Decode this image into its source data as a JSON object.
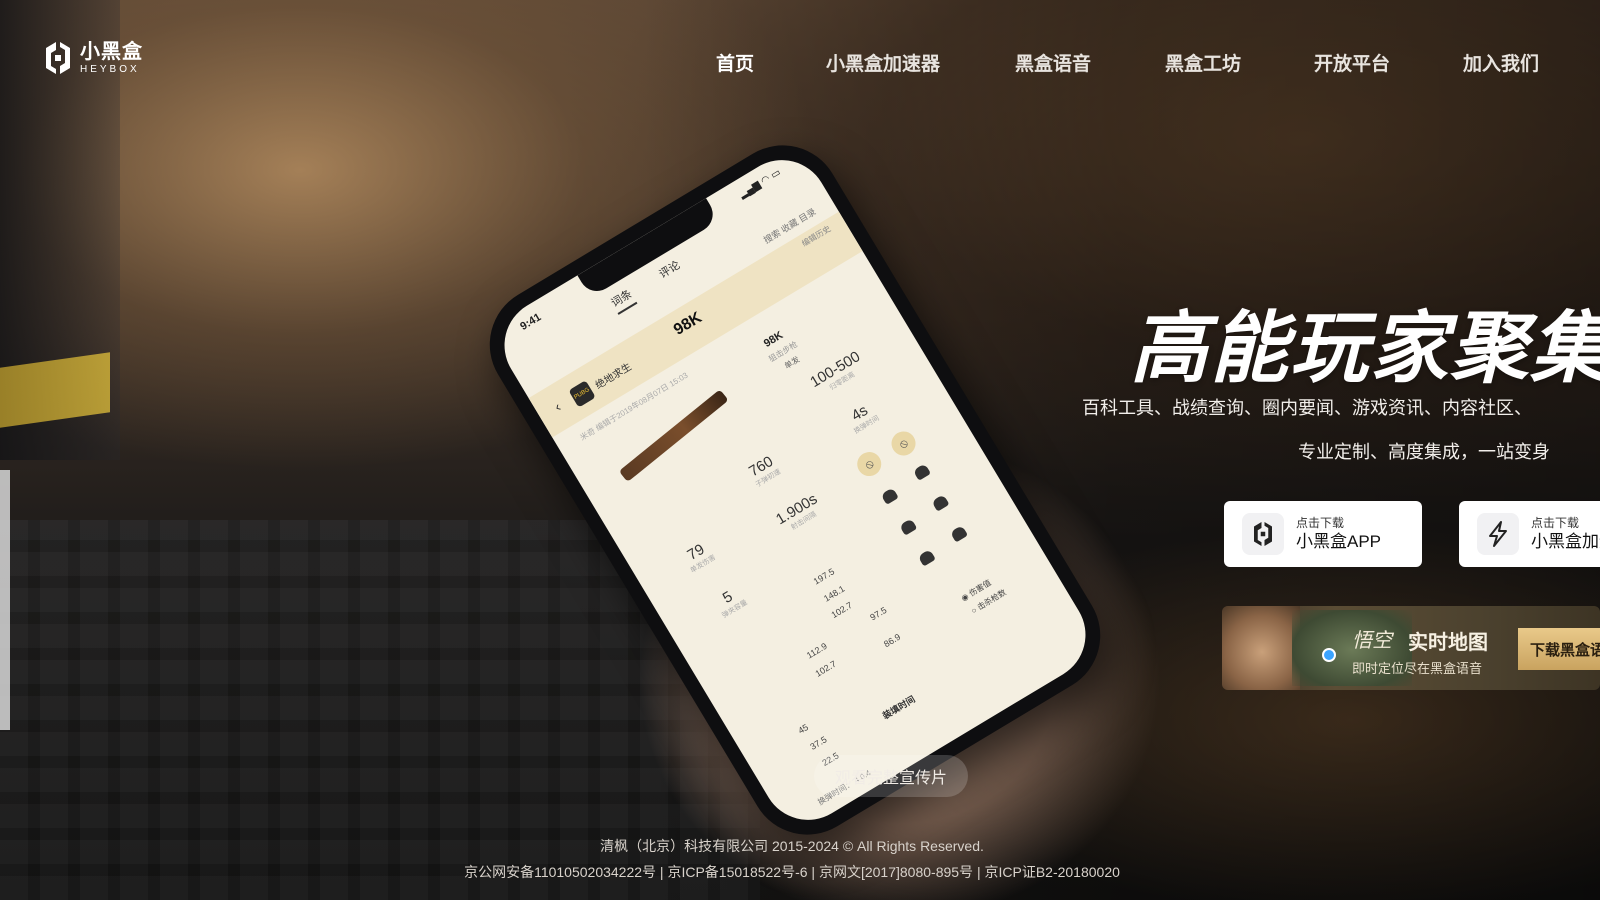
{
  "brand": {
    "name_cn": "小黑盒",
    "name_en": "HEYBOX",
    "logo_icon": "heybox-logo-icon"
  },
  "nav": {
    "items": [
      {
        "label": "首页",
        "active": true
      },
      {
        "label": "小黑盒加速器",
        "active": false
      },
      {
        "label": "黑盒语音",
        "active": false
      },
      {
        "label": "黑盒工坊",
        "active": false
      },
      {
        "label": "开放平台",
        "active": false
      },
      {
        "label": "加入我们",
        "active": false
      }
    ]
  },
  "hero": {
    "title": "高能玩家聚集",
    "subtitle_line1": "百科工具、战绩查询、圈内要闻、游戏资讯、内容社区、",
    "subtitle_line2": "专业定制、高度集成，一站变身"
  },
  "downloads": [
    {
      "small": "点击下载",
      "big": "小黑盒APP",
      "icon": "heybox-app-icon"
    },
    {
      "small": "点击下载",
      "big": "小黑盒加速器",
      "icon": "lightning-icon"
    }
  ],
  "banner": {
    "logo_text": "悟空",
    "title": "实时地图",
    "subtitle": "即时定位尽在黑盒语音",
    "button": "下载黑盒语音"
  },
  "video": {
    "watch_label": "观看完整宣传片"
  },
  "phone_screen": {
    "time": "9:41",
    "tabs": [
      "词条",
      "评论"
    ],
    "actions": "搜索   收藏   目录",
    "game": "绝地求生",
    "game_badge": "PUBG",
    "title": "98K",
    "edit_history": "编辑历史",
    "meta": "米奇  编辑于2019年08月07日 15:03",
    "gun_name": "98K",
    "gun_type": "狙击步枪",
    "gun_mode": "单发",
    "stats": [
      {
        "value": "100-500",
        "label": "归零距离"
      },
      {
        "value": "760",
        "label": "子弹初速"
      },
      {
        "value": "4s",
        "label": "换弹时间"
      },
      {
        "value": "79",
        "label": "单发伤害"
      },
      {
        "value": "1.900s",
        "label": "射击间隔"
      },
      {
        "value": "5",
        "label": "弹夹容量"
      }
    ],
    "damage": [
      "197.5",
      "148.1",
      "102.7",
      "112.9",
      "102.7",
      "97.5",
      "86.9",
      "45",
      "37.5",
      "22.5"
    ],
    "radio_damage": "伤害值",
    "radio_kill": "击杀枪数",
    "section": "装填时间",
    "lower_values": [
      "4",
      "0.4"
    ],
    "lower_label": "换弹时间："
  },
  "footer": {
    "copyright": "清枫（北京）科技有限公司 2015-2024 © All Rights Reserved.",
    "icp_items": [
      "京公网安备11010502034222号",
      "京ICP备15018522号-6",
      "京网文[2017]8080-895号",
      "京ICP证B2-20180020"
    ],
    "separator": " | "
  },
  "colors": {
    "text_primary": "#ffffff",
    "button_bg": "#ffffff",
    "banner_button": "#d8b576"
  }
}
